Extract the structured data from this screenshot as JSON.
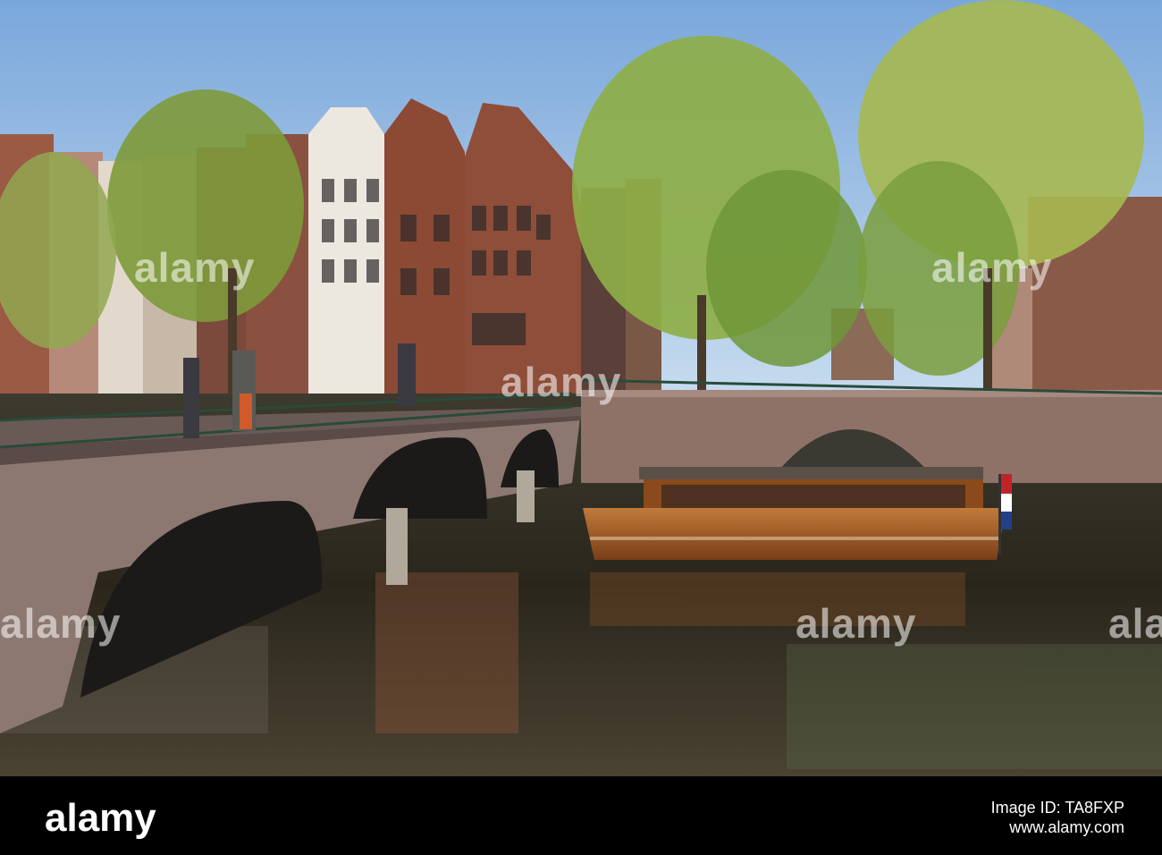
{
  "photo": {
    "subject": "canal-bridges-and-tour-boat",
    "colors": {
      "sky": "#8fb4e0",
      "water": "#2a2a22",
      "bridge": "#8a7a70",
      "boat": "#a0602a",
      "trees": "#8aa848",
      "footer": "#000000"
    }
  },
  "watermark": {
    "text": "alamy"
  },
  "footer": {
    "logo": "alamy",
    "image_id_label": "Image ID: TA8FXP",
    "url": "www.alamy.com"
  }
}
